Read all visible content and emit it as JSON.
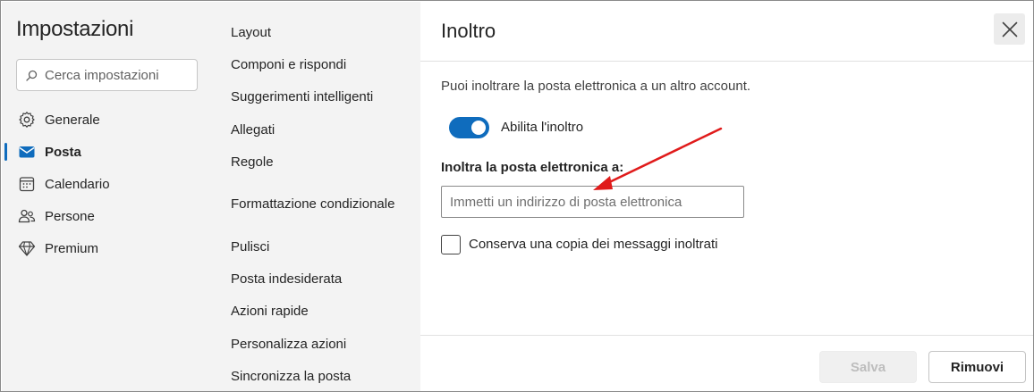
{
  "settings": {
    "title": "Impostazioni",
    "search_placeholder": "Cerca impostazioni"
  },
  "nav": {
    "items": [
      {
        "label": "Generale",
        "icon": "gear-icon",
        "active": false
      },
      {
        "label": "Posta",
        "icon": "mail-icon",
        "active": true
      },
      {
        "label": "Calendario",
        "icon": "calendar-icon",
        "active": false
      },
      {
        "label": "Persone",
        "icon": "people-icon",
        "active": false
      },
      {
        "label": "Premium",
        "icon": "diamond-icon",
        "active": false
      }
    ]
  },
  "mail_settings": {
    "items": [
      "Layout",
      "Componi e rispondi",
      "Suggerimenti intelligenti",
      "Allegati",
      "Regole",
      "Formattazione condizionale",
      "Pulisci",
      "Posta indesiderata",
      "Azioni rapide",
      "Personalizza azioni",
      "Sincronizza la posta"
    ]
  },
  "forwarding": {
    "title": "Inoltro",
    "description": "Puoi inoltrare la posta elettronica a un altro account.",
    "toggle_label": "Abilita l'inoltro",
    "toggle_on": true,
    "field_label": "Inoltra la posta elettronica a:",
    "email_placeholder": "Immetti un indirizzo di posta elettronica",
    "email_value": "",
    "keep_copy_label": "Conserva una copia dei messaggi inoltrati",
    "keep_copy_checked": false,
    "save_label": "Salva",
    "remove_label": "Rimuovi"
  },
  "colors": {
    "accent": "#0f6cbd",
    "pane_background": "#f3f3f3",
    "annotation_arrow": "#e01b1b"
  }
}
